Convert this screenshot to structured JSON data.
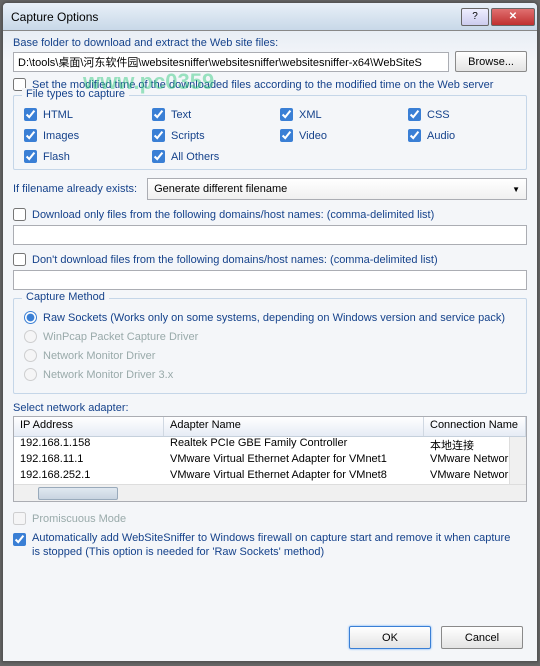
{
  "window": {
    "title": "Capture Options"
  },
  "watermark": "www.pc0359",
  "baseFolder": {
    "label": "Base folder to download and extract the Web site files:",
    "value": "D:\\tools\\桌面\\河东软件园\\websitesniffer\\websitesniffer\\websitesniffer-x64\\WebSiteS",
    "browse": "Browse..."
  },
  "modifiedTime": {
    "checked": false,
    "label": "Set the modified time of the downloaded files according to the modified time on the Web server"
  },
  "fileTypes": {
    "legend": "File types to capture",
    "items": [
      {
        "label": "HTML",
        "checked": true
      },
      {
        "label": "Text",
        "checked": true
      },
      {
        "label": "XML",
        "checked": true
      },
      {
        "label": "CSS",
        "checked": true
      },
      {
        "label": "Images",
        "checked": true
      },
      {
        "label": "Scripts",
        "checked": true
      },
      {
        "label": "Video",
        "checked": true
      },
      {
        "label": "Audio",
        "checked": true
      },
      {
        "label": "Flash",
        "checked": true
      },
      {
        "label": "All Others",
        "checked": true
      }
    ]
  },
  "filenameExists": {
    "label": "If filename already exists:",
    "value": "Generate different filename"
  },
  "downloadOnly": {
    "checked": false,
    "label": "Download only files from the following domains/host names: (comma-delimited list)"
  },
  "dontDownload": {
    "checked": false,
    "label": "Don't download files from the following domains/host names: (comma-delimited list)"
  },
  "captureMethod": {
    "legend": "Capture Method",
    "items": [
      {
        "label": "Raw Sockets  (Works only on some systems, depending on Windows version and service pack)",
        "checked": true,
        "disabled": false
      },
      {
        "label": "WinPcap Packet Capture Driver",
        "checked": false,
        "disabled": true
      },
      {
        "label": "Network Monitor Driver",
        "checked": false,
        "disabled": true
      },
      {
        "label": "Network Monitor Driver 3.x",
        "checked": false,
        "disabled": true
      }
    ]
  },
  "adapter": {
    "label": "Select network adapter:",
    "headers": {
      "ip": "IP Address",
      "name": "Adapter Name",
      "conn": "Connection Name"
    },
    "rows": [
      {
        "ip": "192.168.1.158",
        "name": "Realtek PCIe GBE Family Controller",
        "conn": "本地连接"
      },
      {
        "ip": "192.168.11.1",
        "name": "VMware Virtual Ethernet Adapter for VMnet1",
        "conn": "VMware Network Adapt"
      },
      {
        "ip": "192.168.252.1",
        "name": "VMware Virtual Ethernet Adapter for VMnet8",
        "conn": "VMware Network Adapt"
      }
    ]
  },
  "promiscuous": {
    "checked": false,
    "label": "Promiscuous Mode",
    "disabled": true
  },
  "autoFirewall": {
    "checked": true,
    "label": "Automatically add WebSiteSniffer to Windows firewall on capture start and remove it when capture is stopped (This option is needed for 'Raw Sockets' method)"
  },
  "buttons": {
    "ok": "OK",
    "cancel": "Cancel"
  }
}
